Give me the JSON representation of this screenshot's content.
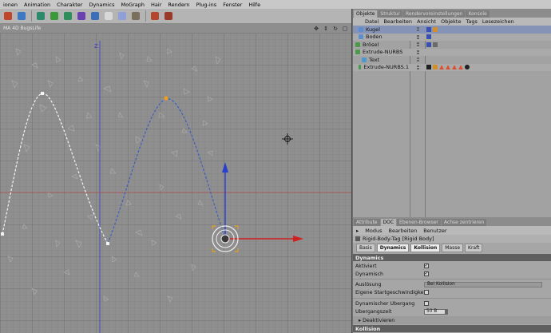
{
  "menubar": {
    "items": [
      "ionen",
      "Animation",
      "Charakter",
      "Dynamics",
      "MoGraph",
      "Hair",
      "Rendern",
      "Plug-ins",
      "Fenster",
      "Hilfe"
    ]
  },
  "toolbar": {
    "icons": [
      {
        "name": "polygon-pen-icon",
        "color": "#c0462b"
      },
      {
        "name": "primitive-cube-icon",
        "color": "#3a78c2"
      },
      {
        "name": "spline-pen-icon",
        "color": "#2a8a6a"
      },
      {
        "name": "nurbs-icon",
        "color": "#3a9a3a"
      },
      {
        "name": "array-icon",
        "color": "#2f8f5a"
      },
      {
        "name": "deformer-icon",
        "color": "#6a3fb0"
      },
      {
        "name": "scene-icon",
        "color": "#3d6fb8"
      },
      {
        "name": "light-icon",
        "color": "#d8d8d8"
      },
      {
        "name": "camera-icon",
        "color": "#8f9fd8"
      },
      {
        "name": "hair-icon",
        "color": "#7a6f5a"
      },
      {
        "name": "render-region-icon",
        "color": "#b6462b"
      },
      {
        "name": "render-view-icon",
        "color": "#9a3a2a"
      }
    ]
  },
  "viewport": {
    "tab_label": "MA 4D BugsLife",
    "axis_label": "Z",
    "controls": [
      "move-view",
      "zoom-view",
      "rotate-view",
      "maximize-view"
    ]
  },
  "objects": {
    "tabs": [
      "Objekte",
      "Struktur",
      "Rendervoreinstellungen",
      "Konsole"
    ],
    "active_tab": 0,
    "menu": [
      "Datei",
      "Bearbeiten",
      "Ansicht",
      "Objekte",
      "Tags",
      "Lesezeichen"
    ],
    "rows": [
      {
        "name": "Kugel",
        "icon_color": "#5b8fd0",
        "selected": true,
        "indent": 1
      },
      {
        "name": "Boden",
        "icon_color": "#5b8fd0",
        "selected": false,
        "indent": 1
      },
      {
        "name": "Brösel",
        "icon_color": "#4a9a4a",
        "selected": false,
        "indent": 0
      },
      {
        "name": "Extrude-NURBS",
        "icon_color": "#4a9a4a",
        "selected": false,
        "indent": 0
      },
      {
        "name": "Text",
        "icon_color": "#4a9ad0",
        "selected": false,
        "indent": 2
      },
      {
        "name": "Extrude-NURBS.1",
        "icon_color": "#4a9a4a",
        "selected": false,
        "indent": 1
      }
    ]
  },
  "attributes": {
    "tabs": [
      "Attribute",
      "DOC",
      "Ebenen-Browser",
      "Achse zentrieren"
    ],
    "active_tab": 1,
    "menu": [
      "Modus",
      "Bearbeiten",
      "Benutzer"
    ],
    "title": "Rigid-Body-Tag [Rigid Body]",
    "subtabs": [
      "Basis",
      "Dynamics",
      "Kollision",
      "Masse",
      "Kraft"
    ],
    "active_subtabs": [
      1,
      2
    ],
    "section_dynamics": "Dynamics",
    "aktiviert_label": "Aktiviert",
    "dynamisch_label": "Dynamisch",
    "ausloesung_label": "Auslösung",
    "ausloesung_value": "Bei Kollision",
    "eigene_label": "Eigene Startgeschwindigkeit",
    "dyn_uebergang_label": "Dynamischer Übergang",
    "uebergangszeit_label": "Übergangszeit",
    "uebergangszeit_value": "50 B",
    "deaktivieren_label": "▸ Deaktivieren",
    "section_kollision": "Kollision",
    "aktiviert_checked": true,
    "dynamisch_checked": true,
    "eigene_checked": false,
    "dyn_uebergang_checked": false
  }
}
